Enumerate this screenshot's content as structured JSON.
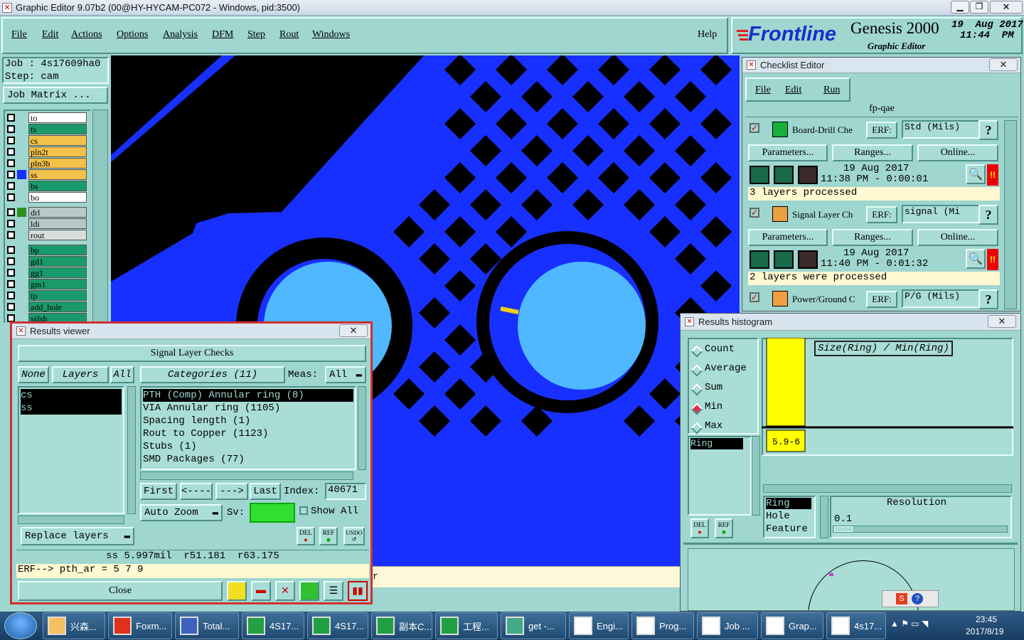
{
  "window": {
    "title": "Graphic Editor 9.07b2 (00@HY-HYCAM-PC072 - Windows, pid:3500)"
  },
  "menu": {
    "items": [
      "File",
      "Edit",
      "Actions",
      "Options",
      "Analysis",
      "DFM",
      "Step",
      "Rout",
      "Windows"
    ],
    "help": "Help"
  },
  "brand": {
    "logo": "Frontline",
    "product": "Genesis 2000",
    "sub": "Graphic Editor",
    "date": "19  Aug 2017",
    "time": "11:44  PM"
  },
  "job": {
    "job_label": "Job : 4s17609ha0",
    "step_label": "Step: cam",
    "matrix_button": "Job Matrix ..."
  },
  "layers": [
    {
      "name": "to",
      "color": "#ffffff",
      "swatch": ""
    },
    {
      "name": "ts",
      "color": "#1a9a6a",
      "swatch": ""
    },
    {
      "name": "cs",
      "color": "#f2c14a",
      "swatch": ""
    },
    {
      "name": "pln2t",
      "color": "#f2c14a",
      "swatch": ""
    },
    {
      "name": "pln3b",
      "color": "#f2c14a",
      "swatch": ""
    },
    {
      "name": "ss",
      "color": "#f2c14a",
      "swatch": "#1730ff"
    },
    {
      "name": "bs",
      "color": "#1a9a6a",
      "swatch": ""
    },
    {
      "name": "bo",
      "color": "#ffffff",
      "swatch": ""
    },
    {
      "name": "drl",
      "color": "#b8c8c8",
      "swatch": "#2f8f1f"
    },
    {
      "name": "ldi",
      "color": "#b8c8c8",
      "swatch": ""
    },
    {
      "name": "rout",
      "color": "#d8dddd",
      "swatch": ""
    },
    {
      "name": "bp",
      "color": "#1a9a6a",
      "swatch": ""
    },
    {
      "name": "gd1",
      "color": "#1a9a6a",
      "swatch": ""
    },
    {
      "name": "gg1",
      "color": "#1a9a6a",
      "swatch": ""
    },
    {
      "name": "gm1",
      "color": "#1a9a6a",
      "swatch": ""
    },
    {
      "name": "tp",
      "color": "#1a9a6a",
      "swatch": ""
    },
    {
      "name": "add_hole",
      "color": "#1a9a6a",
      "swatch": ""
    },
    {
      "name": "sslsh",
      "color": "#1a9a6a",
      "swatch": ""
    }
  ],
  "checklist": {
    "title": "Checklist Editor",
    "menu": [
      "File",
      "Edit",
      "Run"
    ],
    "name": "fp-qae",
    "checks": [
      {
        "label": "Board-Drill Che",
        "erf": "ERF:",
        "erf_value": "Std (Mils)",
        "date": "19 Aug 2017",
        "time": "11:38 PM - 0:00:01",
        "status": "3 layers processed"
      },
      {
        "label": "Signal Layer Ch",
        "erf": "ERF:",
        "erf_value": "signal (Mi",
        "date": "19 Aug 2017",
        "time": "11:40 PM - 0:01:32",
        "status": "2 layers were processed"
      },
      {
        "label": "Power/Ground C",
        "erf": "ERF:",
        "erf_value": "P/G (Mils)"
      }
    ],
    "buttons": {
      "params": "Parameters...",
      "ranges": "Ranges...",
      "online": "Online..."
    },
    "help": "?",
    "alert": "!!"
  },
  "results": {
    "title": "Results viewer",
    "header": "Signal Layer Checks",
    "none": "None",
    "layers": "Layers",
    "all": "All",
    "categories": "Categories (11)",
    "meas_label": "Meas:",
    "meas_value": "All",
    "layer_list": [
      "cs",
      "ss"
    ],
    "category_list": [
      "PTH (Comp) Annular ring (8)",
      "VIA Annular ring (1105)",
      "Spacing length (1)",
      "Rout to Copper (1123)",
      "Stubs (1)",
      "SMD Packages (77)"
    ],
    "nav": {
      "first": "First",
      "prev": "<----",
      "next": "--->",
      "last": "Last",
      "index_label": "Index:",
      "index_value": "40671"
    },
    "auto_zoom": "Auto Zoom",
    "sv": "Sv:",
    "show_all": "Show All",
    "replace": "Replace layers",
    "del": "DEL",
    "ref": "REF",
    "undo": "UNDO",
    "measure": "ss 5.997mil  r51.181  r63.175",
    "erf_line": "ERF--> pth_ar = 5 7 9",
    "close": "Close"
  },
  "histogram": {
    "title": "Results histogram",
    "options": [
      "Count",
      "Average",
      "Sum",
      "Min",
      "Max"
    ],
    "selected": "Min",
    "label": "Size(Ring) / Min(Ring)",
    "value": "5.997",
    "bin": "5.9-6",
    "list_item": "Ring",
    "del": "DEL",
    "ref": "REF",
    "by_list": [
      "Ring",
      "Hole",
      "Feature"
    ],
    "resolution_label": "Resolution",
    "resolution_value": "0.1",
    "chart_data": {
      "type": "bar",
      "categories": [
        "5.9-6"
      ],
      "values": [
        5.997
      ],
      "title": "Size(Ring) / Min(Ring)"
    }
  },
  "status_strip": {
    "fragment": "r"
  },
  "taskbar": {
    "items": [
      "兴森...",
      "Foxm...",
      "Total...",
      "4S17...",
      "4S17...",
      "副本C...",
      "工程...",
      "get -...",
      "Engi...",
      "Prog...",
      "Job ...",
      "Grap...",
      "4s17..."
    ],
    "time": "23:45",
    "date": "2017/8/19"
  }
}
